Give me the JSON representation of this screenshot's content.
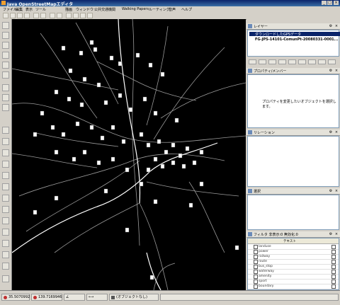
{
  "window": {
    "title": "Java OpenStreetMapエディタ",
    "controls": [
      "_",
      "□",
      "×"
    ]
  },
  "menu": [
    "ファイル",
    "編集",
    "表示",
    "ツール",
    "描画",
    "ウィンドウ",
    "公共交通機関",
    "Walking Papers",
    "ルーティング",
    "音声",
    "ヘルプ"
  ],
  "layers": {
    "title": "レイヤー",
    "items": [
      "ダウンロードしたGPSデータ",
      "FG-JPS-14101-ComunPt-20080331-0001..."
    ]
  },
  "properties": {
    "title": "プロパティ/メンバー",
    "hint": "プロパティを変更したいオブジェクトを選択します。"
  },
  "relations": {
    "title": "リレーション"
  },
  "selection": {
    "title": "選択"
  },
  "filter": {
    "title": "フィルタ 非表示:0 無効化:0",
    "column": "テキスト",
    "rows": [
      "landuse",
      "power",
      "railway",
      "route",
      "bus_stop",
      "waterway",
      "amenity",
      "sport",
      "boundary",
      "leisure"
    ]
  },
  "status": {
    "lat": "35.5070992",
    "lon": "139.7169946",
    "heading": "",
    "distance": "",
    "selection": "(オブジェクトなし)"
  }
}
